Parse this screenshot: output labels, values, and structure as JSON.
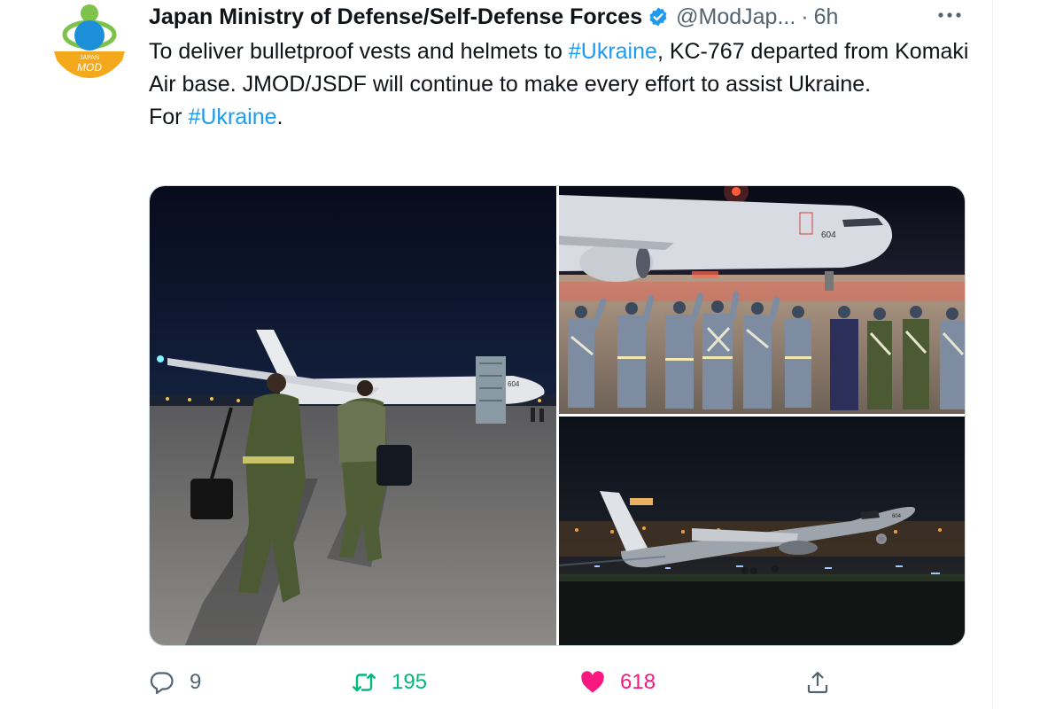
{
  "tweet": {
    "author_name": "Japan Ministry of Defense/Self-Defense Forces",
    "handle": "@ModJap...",
    "separator": "·",
    "time": "6h",
    "avatar_text_top": "JAPAN",
    "avatar_text_bottom": "MOD",
    "text": {
      "line1_pre": "To deliver bulletproof vests and helmets to ",
      "line1_hashtag": "#Ukraine",
      "line1_post": ", KC-767 departed from Komaki Air base. JMOD/JSDF will continue to make every effort to assist Ukraine.",
      "line2_pre": "For ",
      "line2_hashtag": "#Ukraine",
      "line2_post": "."
    },
    "photos": {
      "tail_number": "604"
    },
    "actions": {
      "replies": "9",
      "retweets": "195",
      "likes": "618"
    }
  },
  "colors": {
    "hashtag": "#1d9bf0",
    "retweet": "#00ba7c",
    "like": "#f91880",
    "muted": "#536471",
    "verified": "#1d9bf0"
  },
  "icons": [
    "verified-badge-icon",
    "more-icon",
    "reply-icon",
    "retweet-icon",
    "like-icon",
    "share-icon"
  ]
}
